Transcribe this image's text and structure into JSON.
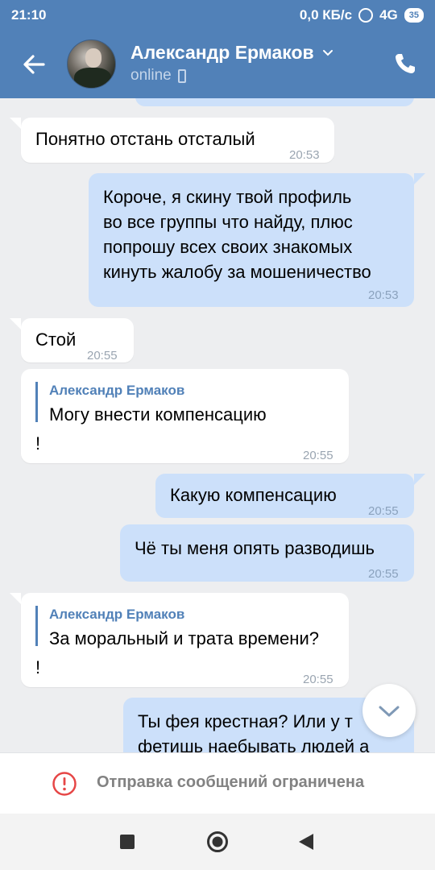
{
  "status_bar": {
    "time": "21:10",
    "network_speed": "0,0 КБ/с",
    "network_type": "4G",
    "battery": "35"
  },
  "header": {
    "contact_name": "Александр Ермаков",
    "contact_status": "online",
    "back_icon": "arrow-left-icon",
    "call_icon": "phone-icon"
  },
  "messages": [
    {
      "dir": "in",
      "text": "Понятно отстань отсталый",
      "time": "20:53"
    },
    {
      "dir": "out",
      "lines": [
        "Короче, я скину твой профиль",
        "во все группы что найду, плюс",
        "попрошу всех своих знакомых",
        "кинуть жалобу за мошеничество"
      ],
      "time": "20:53"
    },
    {
      "dir": "in",
      "text": "Стой",
      "time": "20:55"
    },
    {
      "dir": "in",
      "quote_name": "Александр Ермаков",
      "quote_text": "Могу внести компенсацию",
      "text": "!",
      "time": "20:55"
    },
    {
      "dir": "out",
      "text": "Какую компенсацию",
      "time": "20:55"
    },
    {
      "dir": "out",
      "text": "Чё ты меня опять разводишь",
      "time": "20:55"
    },
    {
      "dir": "in",
      "quote_name": "Александр Ермаков",
      "quote_text": "За моральный и трата времени?",
      "text": "!",
      "time": "20:55"
    },
    {
      "dir": "out",
      "lines": [
        "Ты фея крестная? Или у т",
        "фетишь наебывать людей а"
      ]
    }
  ],
  "banner": {
    "text": "Отправка сообщений ограничена",
    "icon": "warning-icon",
    "color": "#e64646"
  },
  "colors": {
    "header": "#5181b8",
    "outgoing": "#cce0fa",
    "background": "#edeef0"
  }
}
